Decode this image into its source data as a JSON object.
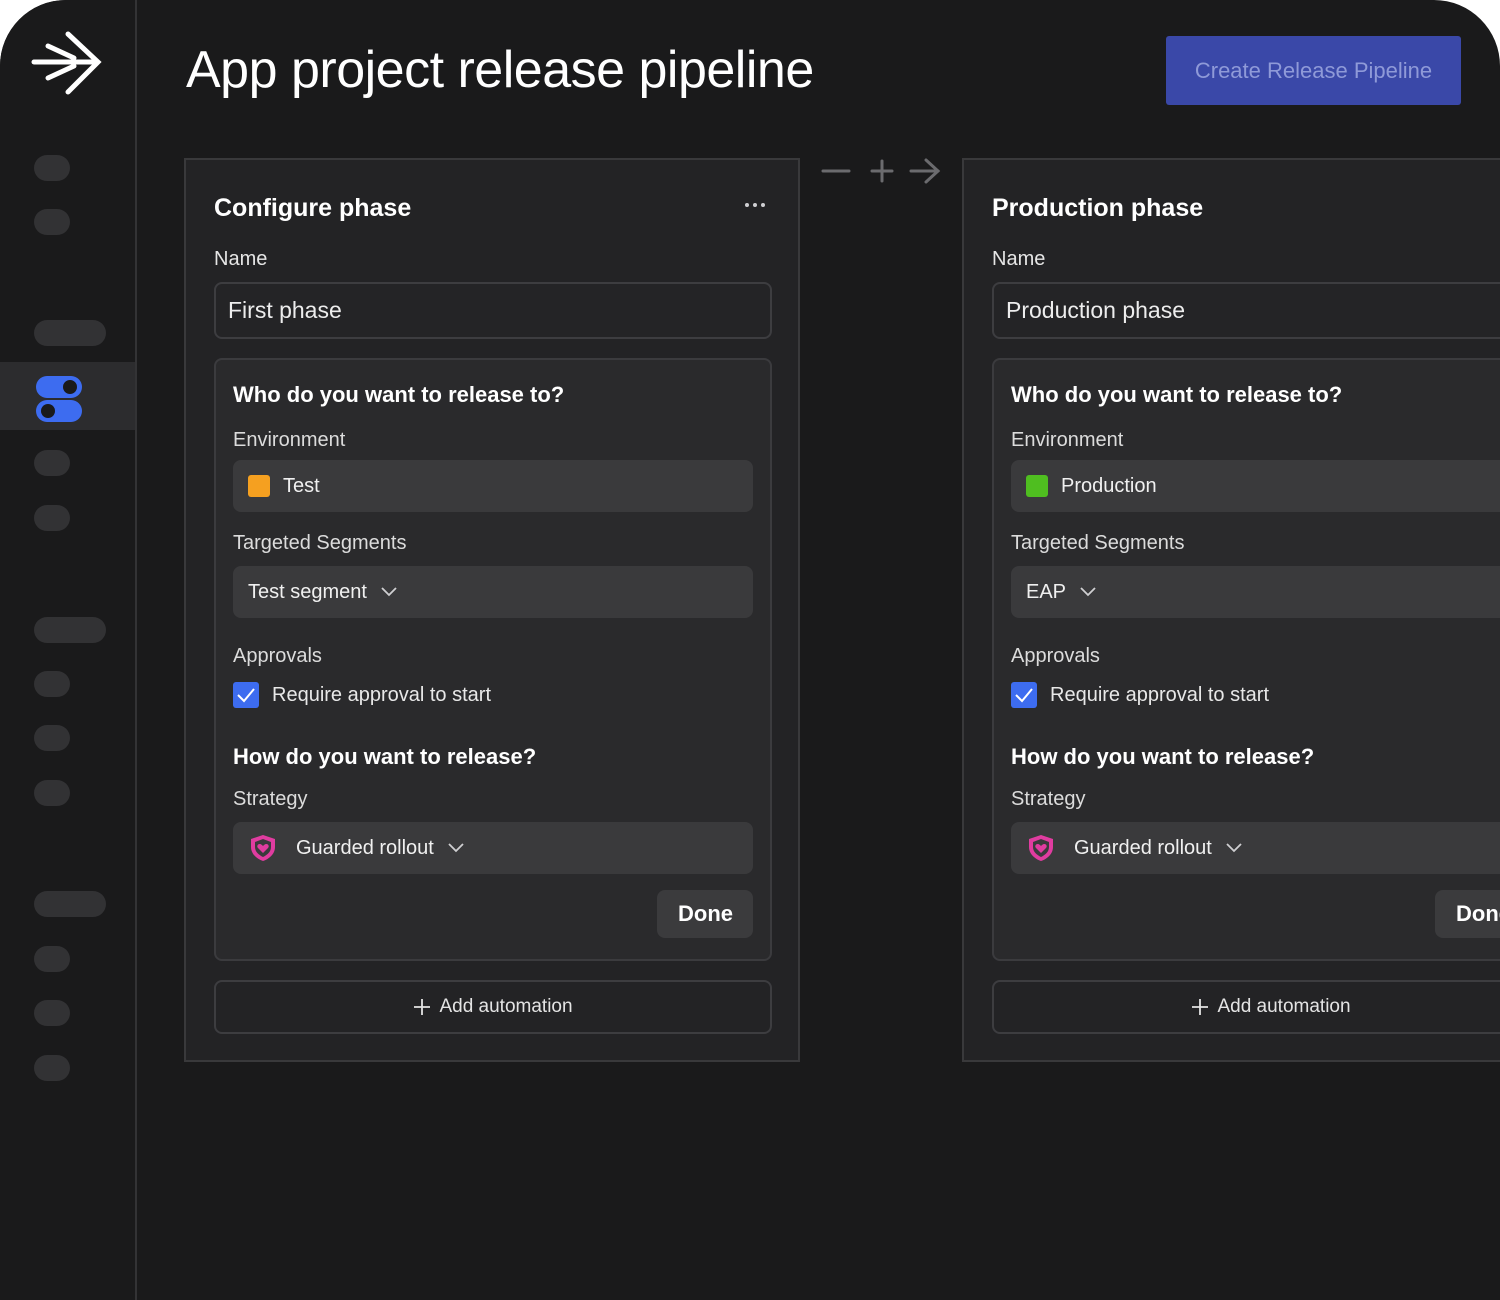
{
  "page_title": "App project release pipeline",
  "create_button": "Create Release Pipeline",
  "colors": {
    "background": "#1a1a1b",
    "accent_button": "#3a48a8",
    "checkbox": "#3d6cf0",
    "test_env": "#f5a020",
    "production_env": "#4fbe20",
    "guarded_rollout_icon": "#e03ca0"
  },
  "icons": [
    "logo-arrow-icon",
    "toggle-flags-icon",
    "more-icon",
    "minus-icon",
    "plus-icon",
    "arrow-right-icon",
    "chevron-down-icon",
    "shield-heart-icon",
    "checkmark-icon"
  ],
  "phases": [
    {
      "title": "Configure phase",
      "name_label": "Name",
      "name_value": "First phase",
      "release_to_heading": "Who do you want to release to?",
      "environment_label": "Environment",
      "environment_value": "Test",
      "segments_label": "Targeted Segments",
      "segments_value": "Test segment",
      "approvals_label": "Approvals",
      "approval_checkbox_label": "Require approval to start",
      "release_how_heading": "How do you want to release?",
      "strategy_label": "Strategy",
      "strategy_value": "Guarded rollout",
      "done_label": "Done",
      "add_automation_label": "Add automation"
    },
    {
      "title": "Production phase",
      "name_label": "Name",
      "name_value": "Production phase",
      "release_to_heading": "Who do you want to release to?",
      "environment_label": "Environment",
      "environment_value": "Production",
      "segments_label": "Targeted Segments",
      "segments_value": "EAP",
      "approvals_label": "Approvals",
      "approval_checkbox_label": "Require approval to start",
      "release_how_heading": "How do you want to release?",
      "strategy_label": "Strategy",
      "strategy_value": "Guarded rollout",
      "done_label": "Done",
      "add_automation_label": "Add automation"
    }
  ]
}
